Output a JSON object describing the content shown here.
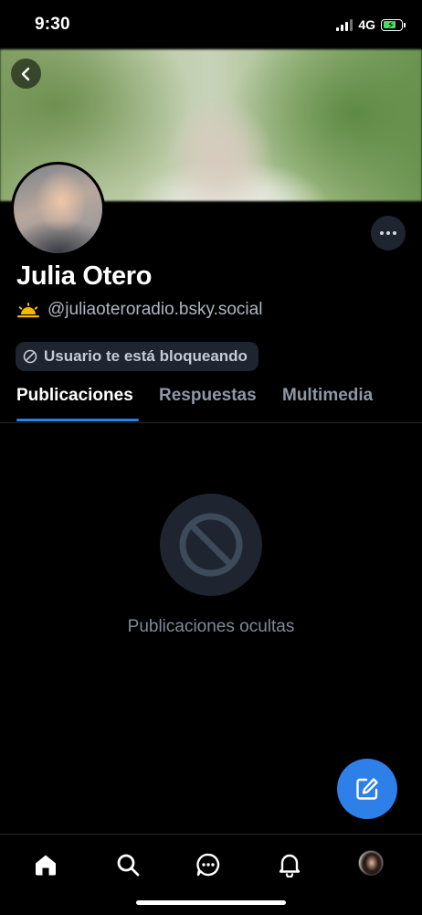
{
  "status_bar": {
    "time": "9:30",
    "network": "4G",
    "battery_level_fraction": 0.75
  },
  "profile": {
    "display_name": "Julia Otero",
    "handle": "@juliaoteroradio.bsky.social",
    "handle_icon": "sun-emoji-icon",
    "blocked_label": "Usuario te está bloqueando",
    "more_icon": "ellipsis-icon",
    "back_icon": "chevron-left-icon"
  },
  "tabs": [
    {
      "label": "Publicaciones",
      "active": true
    },
    {
      "label": "Respuestas",
      "active": false
    },
    {
      "label": "Multimedia",
      "active": false
    }
  ],
  "empty_state": {
    "icon": "blocked-icon",
    "message": "Publicaciones ocultas"
  },
  "fab": {
    "icon": "compose-icon"
  },
  "bottom_nav": [
    {
      "name": "home",
      "icon": "home-icon",
      "active": true
    },
    {
      "name": "search",
      "icon": "search-icon",
      "active": false
    },
    {
      "name": "chat",
      "icon": "chat-icon",
      "active": false
    },
    {
      "name": "notifications",
      "icon": "bell-icon",
      "active": false
    },
    {
      "name": "profile",
      "icon": "avatar",
      "active": false
    }
  ],
  "colors": {
    "accent": "#2e7fe8",
    "background": "#000000",
    "surface": "#1e2530",
    "muted_text": "#8e98a6"
  }
}
